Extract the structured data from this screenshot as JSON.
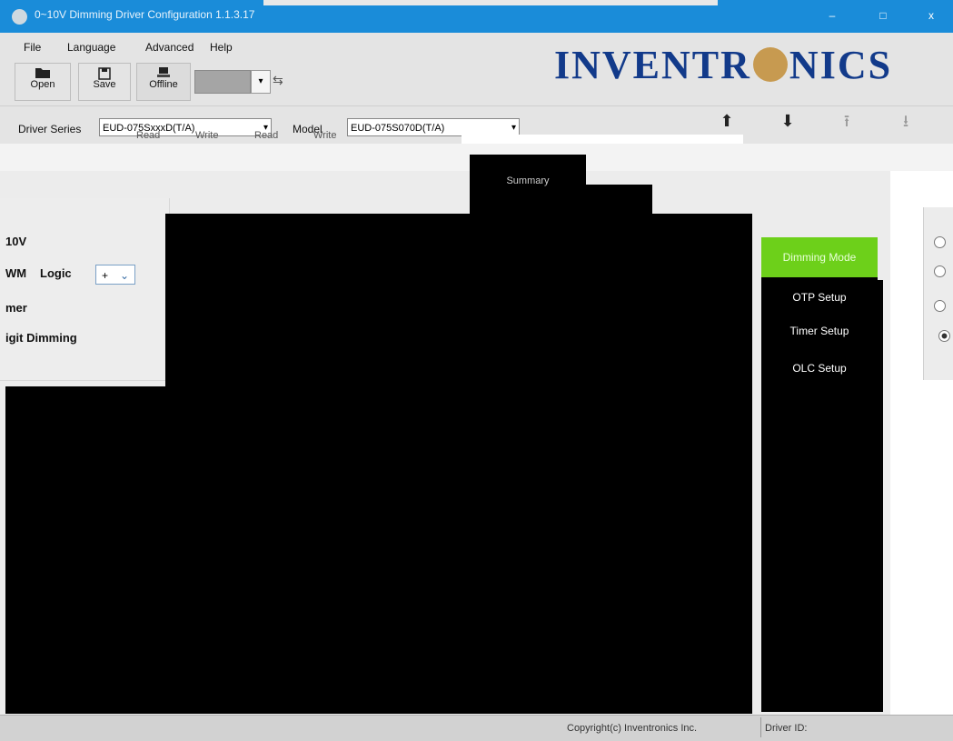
{
  "window": {
    "title": "0~10V Dimming Driver Configuration 1.1.3.17",
    "minimize": "–",
    "maximize": "□",
    "close": "x",
    "color": "#1a8cd9"
  },
  "menu": [
    "File",
    "Language",
    "Advanced",
    "Help"
  ],
  "toolbar": {
    "open": "Open",
    "save": "Save",
    "offline": "Offline",
    "port_dropdown": "▾",
    "usb_icon": "⇆"
  },
  "brand": {
    "logo_text": "INVENTR",
    "logo_text2": "NICS"
  },
  "driver_row": {
    "series_label": "Driver Series",
    "series_value": "EUD-075SxxxD(T/A)",
    "model_label": "Model",
    "model_value": "EUD-075S070D(T/A)",
    "ghost_buttons": [
      "Read",
      "Write",
      "Read",
      "Write"
    ],
    "arrow_up": "⬆",
    "arrow_down": "⬇",
    "arrow_up2": "⭱",
    "arrow_down2": "⭳"
  },
  "summary_tab": "Summary",
  "left_options": {
    "opt1": "10V",
    "opt2": "WM",
    "logic_label": "Logic",
    "logic_value": "+",
    "opt3": "mer",
    "opt4": "igit Dimming"
  },
  "nav": {
    "dimming_mode": "Dimming Mode",
    "otp_setup": "OTP Setup",
    "timer_setup": "Timer Setup",
    "olc_setup": "OLC Setup",
    "active_color": "#6dd01a"
  },
  "status": {
    "copyright": "Copyright(c) Inventronics Inc.",
    "driver_id_label": "Driver ID:"
  }
}
